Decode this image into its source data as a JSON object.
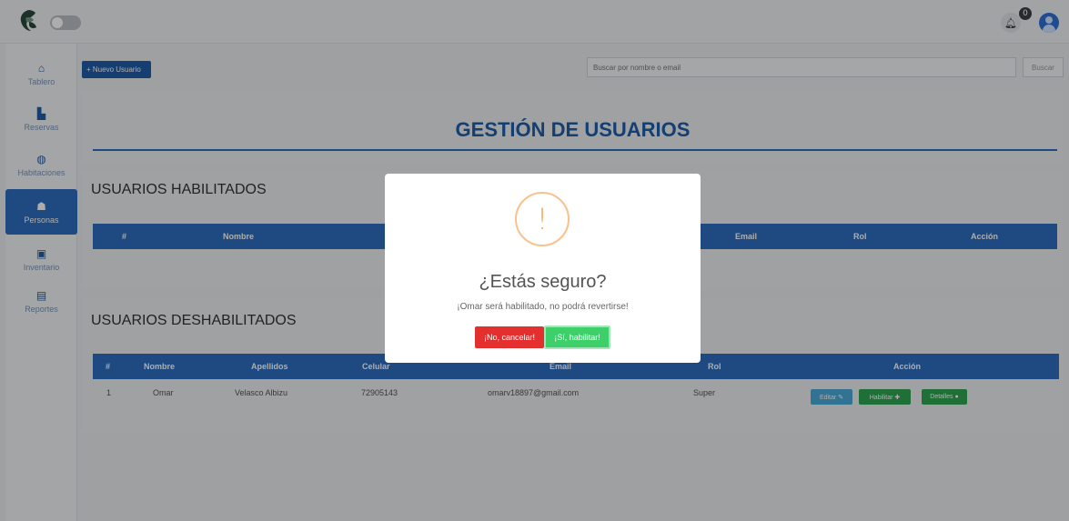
{
  "topbar": {
    "notification_count": "0"
  },
  "sidebar": {
    "items": [
      {
        "label": "Tablero",
        "icon": "home-icon",
        "glyph": "⌂"
      },
      {
        "label": "Reservas",
        "icon": "reservations-icon",
        "glyph": "▙"
      },
      {
        "label": "Habitaciones",
        "icon": "rooms-icon",
        "glyph": "◍"
      },
      {
        "label": "Personas",
        "icon": "people-icon",
        "glyph": "☗"
      },
      {
        "label": "Inventario",
        "icon": "inventory-icon",
        "glyph": "▣"
      },
      {
        "label": "Reportes",
        "icon": "reports-icon",
        "glyph": "▤"
      }
    ],
    "active_index": 3
  },
  "toolbar": {
    "new_user_label": "+ Nuevo Usuario",
    "search_placeholder": "Buscar por nombre o email",
    "search_button": "Buscar"
  },
  "page": {
    "title": "GESTIÓN DE USUARIOS"
  },
  "enabled_users": {
    "title": "USUARIOS HABILITADOS",
    "columns": [
      "#",
      "Nombre",
      "Email",
      "Rol",
      "Acción"
    ]
  },
  "disabled_users": {
    "title": "USUARIOS DESHABILITADOS",
    "columns": [
      "#",
      "Nombre",
      "Apellidos",
      "Celular",
      "Email",
      "Rol",
      "Acción"
    ],
    "rows": [
      {
        "num": "1",
        "nombre": "Omar",
        "apellidos": "Velasco Albizu",
        "celular": "72905143",
        "email": "omarv18897@gmail.com",
        "rol": "Super"
      }
    ],
    "actions": {
      "edit": "Editar ✎",
      "enable": "Habilitar ✚",
      "details": "Detalles ●"
    }
  },
  "modal": {
    "icon": "warning-icon",
    "icon_glyph": "!",
    "title": "¿Estás seguro?",
    "text": "¡Omar será habilitado, no podrá revertirse!",
    "cancel_label": "¡No, cancelar!",
    "confirm_label": "¡Sí, habilitar!"
  },
  "colors": {
    "primary": "#2d6dbf",
    "danger": "#e3302f",
    "success": "#3dd06a",
    "warning": "#f8a55c"
  }
}
